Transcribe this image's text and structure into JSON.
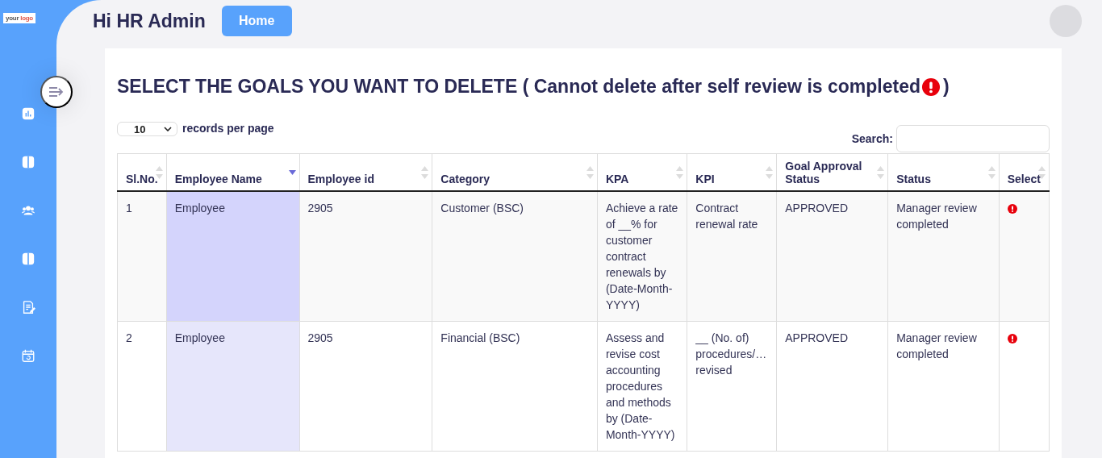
{
  "logo": {
    "part_1": "your",
    "part_2": "logo"
  },
  "header": {
    "greeting": "Hi HR Admin",
    "home_button": "Home"
  },
  "sidebar": {
    "items": [
      {
        "kind": "chart"
      },
      {
        "kind": "book"
      },
      {
        "kind": "team"
      },
      {
        "kind": "book"
      },
      {
        "kind": "form"
      },
      {
        "kind": "calendar"
      }
    ]
  },
  "page": {
    "title": "SELECT THE GOALS YOU WANT TO DELETE ( Cannot delete after self review is completed ",
    "title_end": ")"
  },
  "length_select": {
    "value": "10",
    "label": "records per page"
  },
  "search": {
    "label": "Search:"
  },
  "table": {
    "columns": [
      {
        "label": "Sl.No.",
        "sorted": false
      },
      {
        "label": "Employee Name",
        "sorted": true
      },
      {
        "label": "Employee id",
        "sorted": false
      },
      {
        "label": "Category",
        "sorted": false
      },
      {
        "label": "KPA",
        "sorted": false
      },
      {
        "label": "KPI",
        "sorted": false
      },
      {
        "label": "Goal Approval Status",
        "sorted": false
      },
      {
        "label": "Status",
        "sorted": false
      },
      {
        "label": "Select",
        "sorted": false
      }
    ],
    "rows": [
      {
        "cells": [
          "1",
          "Employee",
          "2905",
          "Customer (BSC)",
          "Achieve a rate of __% for customer contract renewals by (Date-Month-YYYY)",
          "Contract renewal rate",
          "APPROVED",
          "Manager review completed"
        ],
        "locked": true
      },
      {
        "cells": [
          "2",
          "Employee",
          "2905",
          "Financial (BSC)",
          "Assess and revise cost accounting procedures and methods by (Date-Month-YYYY)",
          "__ (No. of) procedures/… revised",
          "APPROVED",
          "Manager review completed"
        ],
        "locked": true
      }
    ]
  }
}
